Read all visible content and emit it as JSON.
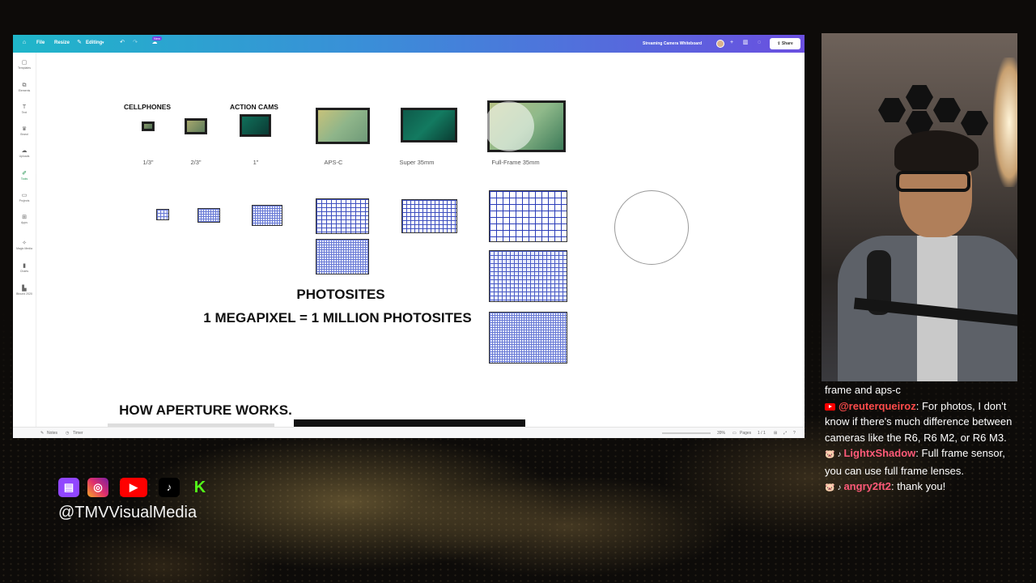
{
  "app": {
    "menu": {
      "file": "File",
      "resize": "Resize",
      "editing": "Editing"
    },
    "new_badge": "New",
    "doc_title": "Streaming Camera Whiteboard",
    "share": "Share",
    "accent_gradient": [
      "#1fb6c9",
      "#6a4fe0"
    ]
  },
  "sidebar": {
    "items": [
      {
        "icon": "templates-icon",
        "label": "Templates"
      },
      {
        "icon": "elements-icon",
        "label": "Elements"
      },
      {
        "icon": "text-icon",
        "label": "Text"
      },
      {
        "icon": "brand-icon",
        "label": "Brand"
      },
      {
        "icon": "uploads-icon",
        "label": "Uploads"
      },
      {
        "icon": "tools-icon",
        "label": "Tools"
      },
      {
        "icon": "projects-icon",
        "label": "Projects"
      },
      {
        "icon": "apps-icon",
        "label": "Apps"
      },
      {
        "icon": "magic-media-icon",
        "label": "Magic Media"
      },
      {
        "icon": "charts-icon",
        "label": "Charts"
      },
      {
        "icon": "bfound-icon",
        "label": "Bfound 2020"
      }
    ]
  },
  "canvas": {
    "headers": {
      "cellphones": "CELLPHONES",
      "action_cams": "ACTION CAMS"
    },
    "sensors": [
      {
        "label": "1/3\""
      },
      {
        "label": "2/3\""
      },
      {
        "label": "1\""
      },
      {
        "label": "APS-C"
      },
      {
        "label": "Super 35mm"
      },
      {
        "label": "Full-Frame 35mm"
      }
    ],
    "photosites_title": "PHOTOSITES",
    "megapixel_line": "1 MEGAPIXEL = 1 MILLION PHOTOSITES",
    "aperture_title": "HOW APERTURE WORKS."
  },
  "bottombar": {
    "notes": "Notes",
    "timer": "Timer",
    "zoom": "39%",
    "pages": "Pages",
    "page_count": "1 / 1"
  },
  "chat": {
    "partial": "frame and aps-c",
    "messages": [
      {
        "user": "@reuterqueiroz",
        "text": ": For photos, I don't know if there's much difference between cameras like the R6, R6 M2, or R6 M3."
      },
      {
        "user": "LightxShadow",
        "text": ": Full frame sensor, you can use full frame lenses."
      },
      {
        "user": "angry2ft2",
        "text": ": thank you!"
      }
    ]
  },
  "socials": {
    "handle": "@TMVVisualMedia",
    "icons": [
      "twitch-icon",
      "instagram-icon",
      "youtube-icon",
      "tiktok-icon",
      "kick-icon"
    ]
  }
}
